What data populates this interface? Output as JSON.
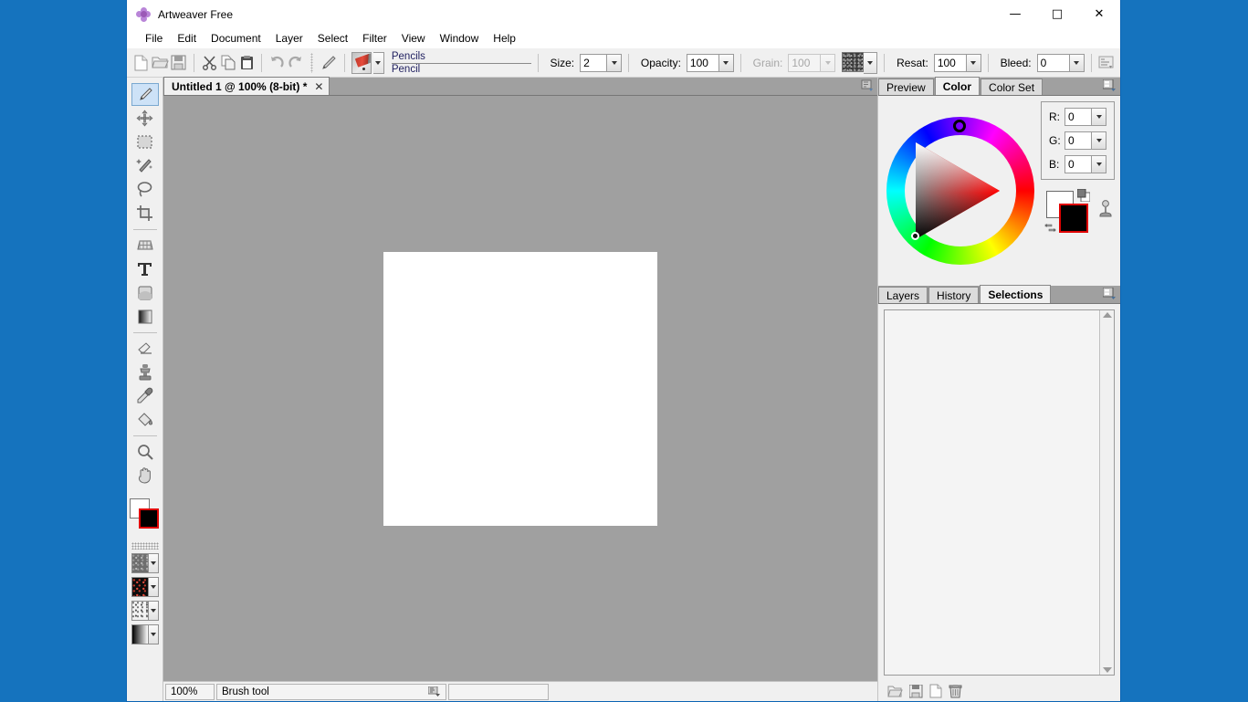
{
  "window": {
    "title": "Artweaver Free",
    "app_icon": "artweaver-flower-icon",
    "minimize": "—",
    "maximize": "□",
    "close": "✕",
    "accent_color": "#1573be"
  },
  "menubar": {
    "items": [
      {
        "label": "File"
      },
      {
        "label": "Edit"
      },
      {
        "label": "Document"
      },
      {
        "label": "Layer"
      },
      {
        "label": "Select"
      },
      {
        "label": "Filter"
      },
      {
        "label": "View"
      },
      {
        "label": "Window"
      },
      {
        "label": "Help"
      }
    ]
  },
  "toolbar": {
    "file_buttons": [
      {
        "name": "new-document-button",
        "icon": "new-file-icon"
      },
      {
        "name": "open-document-button",
        "icon": "open-folder-icon"
      },
      {
        "name": "save-document-button",
        "icon": "save-disk-icon"
      }
    ],
    "edit_buttons": [
      {
        "name": "cut-button",
        "icon": "scissors-icon"
      },
      {
        "name": "copy-button",
        "icon": "copy-icon"
      },
      {
        "name": "paste-button",
        "icon": "paste-clipboard-icon"
      }
    ],
    "history_buttons": [
      {
        "name": "undo-button",
        "icon": "undo-arrow-icon"
      },
      {
        "name": "redo-button",
        "icon": "redo-arrow-icon"
      }
    ],
    "current_tool_icon": "pencil-tool-icon",
    "brush_category": "Pencils",
    "brush_variant": "Pencil",
    "size_label": "Size:",
    "size_value": "2",
    "opacity_label": "Opacity:",
    "opacity_value": "100",
    "grain_label": "Grain:",
    "grain_value": "100",
    "grain_disabled": true,
    "grain_swatch": "grain-texture-swatch",
    "resat_label": "Resat:",
    "resat_value": "100",
    "bleed_label": "Bleed:",
    "bleed_value": "0",
    "options_button_icon": "brush-options-icon"
  },
  "tools": [
    {
      "name": "brush-tool",
      "icon": "paintbrush-icon",
      "active": true
    },
    {
      "name": "move-tool",
      "icon": "move-arrows-icon",
      "active": false
    },
    {
      "name": "rect-select-tool",
      "icon": "rectangular-marquee-icon",
      "active": false
    },
    {
      "name": "magic-wand-tool",
      "icon": "magic-wand-icon",
      "active": false
    },
    {
      "name": "lasso-tool",
      "icon": "lasso-icon",
      "active": false
    },
    {
      "name": "crop-tool",
      "icon": "crop-icon",
      "active": false
    },
    {
      "name": "perspective-tool",
      "icon": "perspective-grid-icon",
      "active": false
    },
    {
      "name": "text-tool",
      "icon": "text-t-icon",
      "active": false
    },
    {
      "name": "shape-tool",
      "icon": "rounded-square-icon",
      "active": false
    },
    {
      "name": "gradient-tool",
      "icon": "gradient-icon",
      "active": false
    },
    {
      "name": "eraser-tool",
      "icon": "eraser-icon",
      "active": false
    },
    {
      "name": "clone-stamp-tool",
      "icon": "clone-stamp-icon",
      "active": false
    },
    {
      "name": "eyedropper-tool",
      "icon": "eyedropper-icon",
      "active": false
    },
    {
      "name": "paint-bucket-tool",
      "icon": "paint-bucket-icon",
      "active": false
    },
    {
      "name": "zoom-tool",
      "icon": "magnifier-icon",
      "active": false
    },
    {
      "name": "hand-tool",
      "icon": "hand-icon",
      "active": false
    }
  ],
  "tool_colors": {
    "foreground": "#000000",
    "background": "#ffffff",
    "selection_outline": "#e00000"
  },
  "pattern_pickers": [
    {
      "name": "grain-picker",
      "swatch": "grain-texture"
    },
    {
      "name": "pattern-picker",
      "swatch": "dark-pattern"
    },
    {
      "name": "texture-picker",
      "swatch": "spray-texture"
    },
    {
      "name": "gradient-picker",
      "swatch": "black-white-gradient"
    }
  ],
  "document": {
    "tab_label": "Untitled 1 @ 100% (8-bit) *",
    "tab_close": "✕",
    "tabs_menu_icon": "document-tabs-menu-icon",
    "canvas_background": "#ffffff",
    "workspace_background": "#a0a0a0"
  },
  "statusbar": {
    "zoom": "100%",
    "tool_name": "Brush tool",
    "tool_menu_icon": "status-tool-menu-icon",
    "extra": ""
  },
  "color_panel": {
    "tabs": [
      {
        "label": "Preview",
        "active": false
      },
      {
        "label": "Color",
        "active": true
      },
      {
        "label": "Color Set",
        "active": false
      }
    ],
    "menu_icon": "panel-menu-icon",
    "wheel_icon": "hsv-color-wheel",
    "hue_marker_icon": "hue-marker-icon",
    "triangle_marker_icon": "saturation-value-marker-icon",
    "channels": [
      {
        "label": "R:",
        "value": "0"
      },
      {
        "label": "G:",
        "value": "0"
      },
      {
        "label": "B:",
        "value": "0"
      }
    ],
    "swatches": {
      "foreground": "#000000",
      "background": "#ffffff",
      "swap_icon": "swap-colors-icon",
      "default_icon": "default-colors-icon",
      "picker_icon": "color-picker-stand-icon"
    }
  },
  "selections_panel": {
    "tabs": [
      {
        "label": "Layers",
        "active": false
      },
      {
        "label": "History",
        "active": false
      },
      {
        "label": "Selections",
        "active": true
      }
    ],
    "menu_icon": "panel-menu-icon",
    "items": [],
    "scroll_up_icon": "scroll-up-arrow-icon",
    "scroll_down_icon": "scroll-down-arrow-icon",
    "footer_buttons": [
      {
        "name": "load-selection-button",
        "icon": "open-folder-icon"
      },
      {
        "name": "save-selection-button",
        "icon": "save-disk-icon"
      },
      {
        "name": "new-selection-button",
        "icon": "new-file-icon"
      },
      {
        "name": "delete-selection-button",
        "icon": "trash-icon"
      }
    ]
  }
}
